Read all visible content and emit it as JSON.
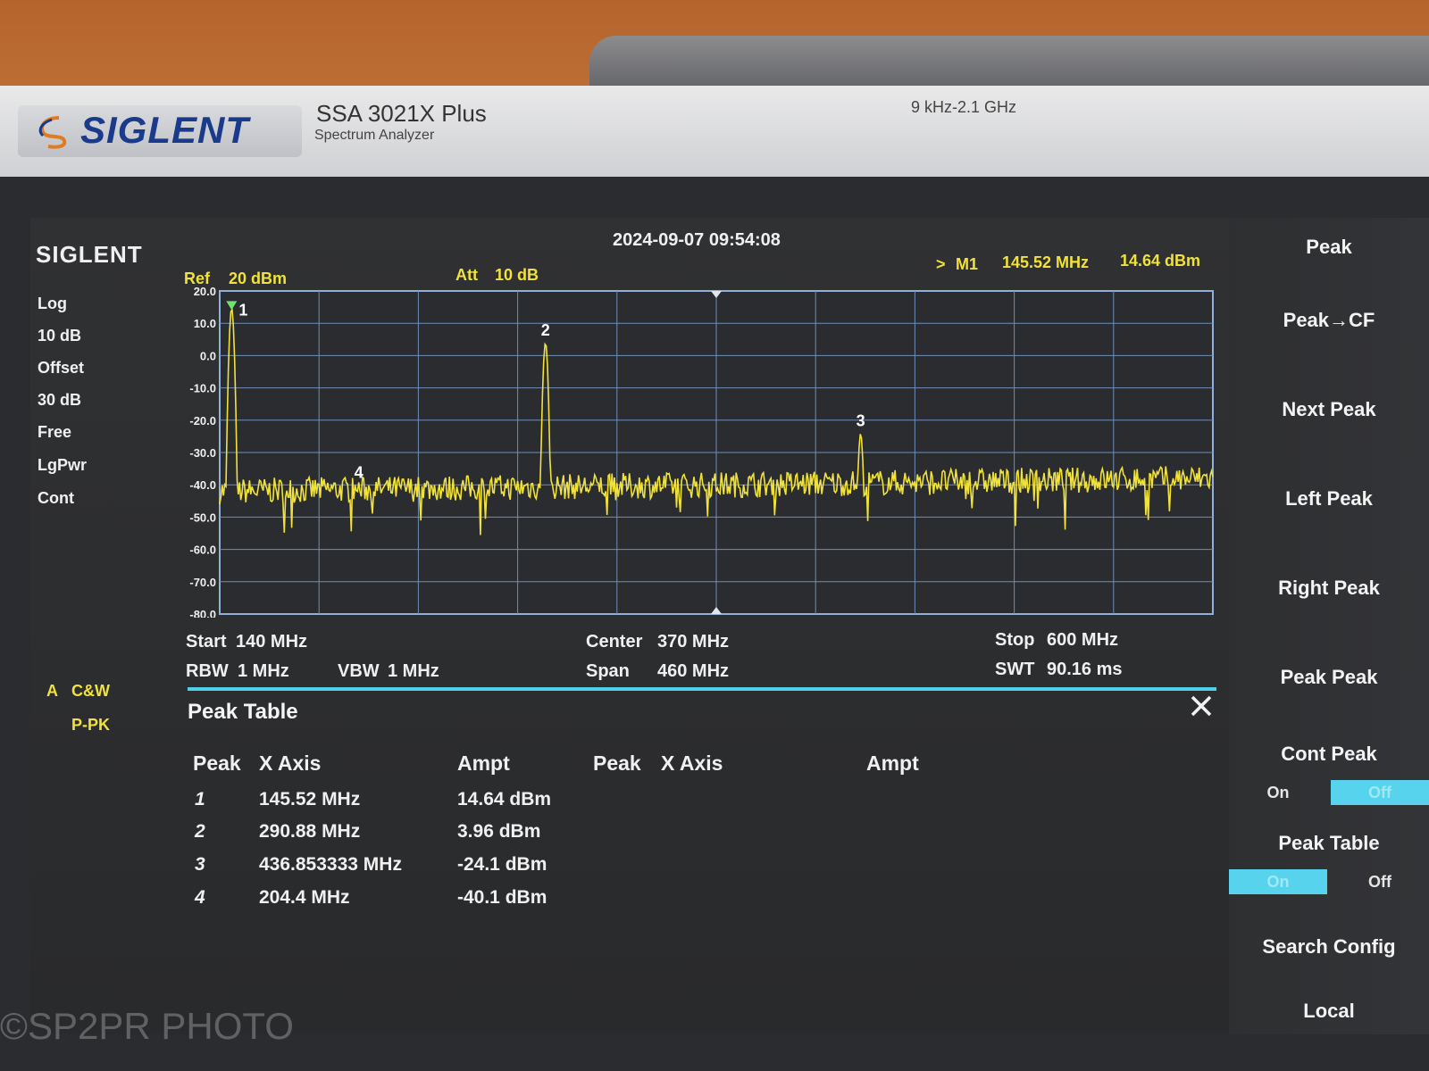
{
  "device": {
    "brand": "SIGLENT",
    "model": "SSA 3021X Plus",
    "subtitle": "Spectrum Analyzer",
    "freq_range": "9 kHz-2.1 GHz"
  },
  "screen": {
    "logo": "SIGLENT",
    "datetime": "2024-09-07 09:54:08",
    "ref": {
      "label": "Ref",
      "value": "20 dBm"
    },
    "att": {
      "label": "Att",
      "value": "10 dB"
    },
    "marker": {
      "arrow": ">",
      "name": "M1",
      "freq": "145.52 MHz",
      "ampt": "14.64 dBm"
    },
    "left_status": [
      "Log",
      "10 dB",
      "Offset",
      "30 dB",
      "Free",
      "LgPwr",
      "Cont"
    ],
    "trace_info": {
      "trace": "A",
      "mode": "C&W",
      "detector": "P-PK"
    },
    "bottom": {
      "start_label": "Start",
      "start_value": "140 MHz",
      "center_label": "Center",
      "center_value": "370 MHz",
      "stop_label": "Stop",
      "stop_value": "600 MHz",
      "rbw_label": "RBW",
      "rbw_value": "1 MHz",
      "vbw_label": "VBW",
      "vbw_value": "1 MHz",
      "span_label": "Span",
      "span_value": "460 MHz",
      "swt_label": "SWT",
      "swt_value": "90.16 ms"
    }
  },
  "chart_data": {
    "type": "line",
    "y_ticks": [
      "20.0",
      "10.0",
      "0.0",
      "-10.0",
      "-20.0",
      "-30.0",
      "-40.0",
      "-50.0",
      "-60.0",
      "-70.0",
      "-80.0"
    ],
    "xlim": [
      140,
      600
    ],
    "ylim": [
      -80,
      20
    ],
    "grid": true,
    "noise_floor": -42,
    "peaks": [
      {
        "label": "1",
        "x": 145.52,
        "y": 14.64
      },
      {
        "label": "2",
        "x": 290.88,
        "y": 3.96
      },
      {
        "label": "3",
        "x": 436.853333,
        "y": -24.1
      },
      {
        "label": "4",
        "x": 204.4,
        "y": -40.1
      }
    ]
  },
  "peak_table": {
    "title": "Peak Table",
    "headers": [
      "Peak",
      "X Axis",
      "Ampt",
      "Peak",
      "X Axis",
      "Ampt"
    ],
    "rows": [
      {
        "peak": "1",
        "x": "145.52 MHz",
        "ampt": "14.64 dBm"
      },
      {
        "peak": "2",
        "x": "290.88 MHz",
        "ampt": "3.96 dBm"
      },
      {
        "peak": "3",
        "x": "436.853333 MHz",
        "ampt": "-24.1 dBm"
      },
      {
        "peak": "4",
        "x": "204.4 MHz",
        "ampt": "-40.1 dBm"
      }
    ]
  },
  "softkeys": {
    "items": [
      "Peak",
      "Peak→CF",
      "Next Peak",
      "Left Peak",
      "Right Peak",
      "Peak Peak",
      "Cont Peak",
      "Peak Table",
      "Search Config",
      "Local"
    ],
    "cont_peak": {
      "on": "On",
      "off": "Off",
      "selected": "Off"
    },
    "peak_table": {
      "on": "On",
      "off": "Off",
      "selected": "On"
    }
  },
  "colors": {
    "trace": "#f0e23a",
    "grid": "#6f8fb8",
    "accent": "#4fd0e8"
  },
  "watermark": "©SP2PR PHOTO"
}
